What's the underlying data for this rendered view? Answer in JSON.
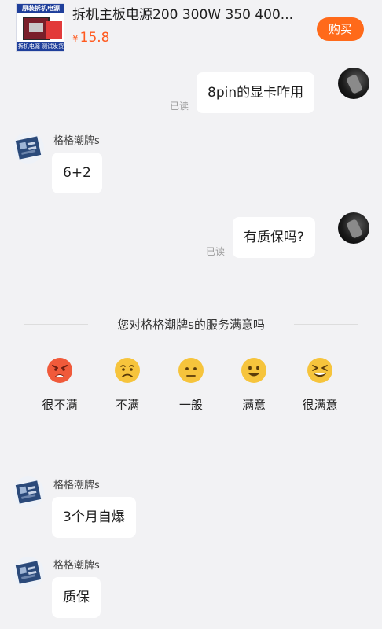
{
  "product": {
    "title": "拆机主板电源200 300W 350 400...",
    "price_symbol": "¥",
    "price": "15.8",
    "buy_label": "购买",
    "thumb_top_text": "原装拆机电源",
    "thumb_bottom_text": "拆机电源 测试发货"
  },
  "messages": [
    {
      "sender": "user",
      "text": "8pin的显卡咋用",
      "status": "已读"
    },
    {
      "sender": "shop",
      "name": "格格潮牌s",
      "text": "6+2"
    },
    {
      "sender": "user",
      "text": "有质保吗?",
      "status": "已读"
    },
    {
      "sender": "shop",
      "name": "格格潮牌s",
      "text": "3个月自爆"
    },
    {
      "sender": "shop",
      "name": "格格潮牌s",
      "text": "质保"
    }
  ],
  "survey": {
    "title": "您对格格潮牌s的服务满意吗",
    "options": [
      {
        "label": "很不满",
        "icon": "very-unsatisfied-face-icon",
        "color": "#f05a3a"
      },
      {
        "label": "不满",
        "icon": "unsatisfied-face-icon",
        "color": "#f6c43c"
      },
      {
        "label": "一般",
        "icon": "neutral-face-icon",
        "color": "#f6c43c"
      },
      {
        "label": "满意",
        "icon": "satisfied-face-icon",
        "color": "#f6c43c"
      },
      {
        "label": "很满意",
        "icon": "very-satisfied-face-icon",
        "color": "#f6c43c"
      }
    ]
  },
  "colors": {
    "accent": "#ff6a1a",
    "price": "#ff5a1f",
    "background": "#f2f2f4",
    "bubble": "#ffffff"
  }
}
